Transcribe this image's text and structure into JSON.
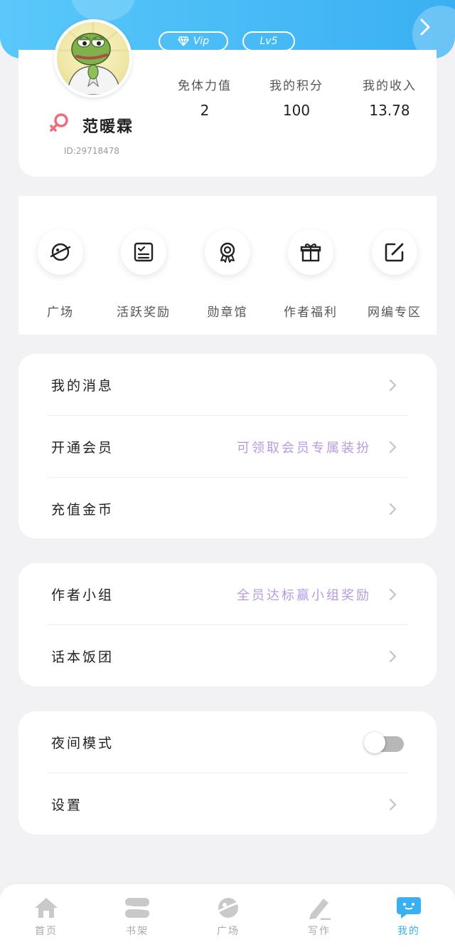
{
  "header": {
    "vip_label": "Vip",
    "level_label": "Lv5"
  },
  "profile": {
    "username": "范暖霖",
    "user_id": "ID:29718478",
    "gender_symbol": "♀",
    "stats": [
      {
        "label": "免体力值",
        "value": "2"
      },
      {
        "label": "我的积分",
        "value": "100"
      },
      {
        "label": "我的收入",
        "value": "13.78"
      }
    ]
  },
  "quick_actions": [
    {
      "label": "广场",
      "icon": "planet-icon"
    },
    {
      "label": "活跃奖励",
      "icon": "checklist-icon"
    },
    {
      "label": "勋章馆",
      "icon": "medal-icon"
    },
    {
      "label": "作者福利",
      "icon": "gift-icon"
    },
    {
      "label": "网编专区",
      "icon": "edit-icon"
    }
  ],
  "menu_group1": {
    "messages": "我的消息",
    "membership": "开通会员",
    "membership_hint": "可领取会员专属装扮",
    "recharge": "充值金币"
  },
  "menu_group2": {
    "author_group": "作者小组",
    "author_group_hint": "全员达标赢小组奖励",
    "fan_club": "话本饭团"
  },
  "menu_group3": {
    "night_mode": "夜间模式",
    "night_mode_on": false,
    "settings": "设置"
  },
  "tabbar": [
    {
      "label": "首页",
      "icon": "home-icon",
      "active": false
    },
    {
      "label": "书架",
      "icon": "bookshelf-icon",
      "active": false
    },
    {
      "label": "广场",
      "icon": "planet-icon",
      "active": false
    },
    {
      "label": "写作",
      "icon": "pen-icon",
      "active": false
    },
    {
      "label": "我的",
      "icon": "chat-bubble-icon",
      "active": true
    }
  ],
  "colors": {
    "accent": "#3ab0f2",
    "hint": "#b79ae0",
    "gender": "#f06a7a"
  }
}
